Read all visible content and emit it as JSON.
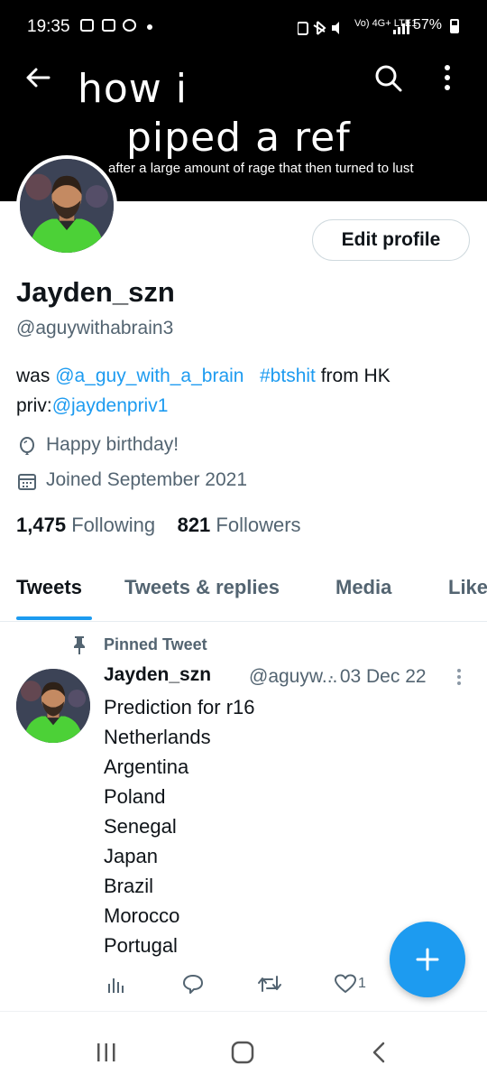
{
  "status_bar": {
    "time": "19:35",
    "signal_text": "Vo) 4G+ LTE1",
    "battery": "57%"
  },
  "banner": {
    "line1": "how i",
    "line2": "piped a ref",
    "caption": "after a large amount of rage that then turned to lust"
  },
  "profile": {
    "edit_label": "Edit profile",
    "display_name": "Jayden_szn",
    "handle": "@aguywithabrain3",
    "bio": {
      "prefix": "was ",
      "mention1": "@a_guy_with_a_brain",
      "hashtag": "#btshit",
      "after_hashtag": " from HK",
      "priv_label": "priv:",
      "mention2": "@jaydenpriv1"
    },
    "birthday": "Happy birthday!",
    "joined": "Joined September 2021",
    "following_count": "1,475",
    "following_label": "Following",
    "followers_count": "821",
    "followers_label": "Followers"
  },
  "tabs": [
    {
      "label": "Tweets",
      "active": true
    },
    {
      "label": "Tweets & replies",
      "active": false
    },
    {
      "label": "Media",
      "active": false
    },
    {
      "label": "Likes",
      "active": false
    }
  ],
  "tweet": {
    "pinned_label": "Pinned Tweet",
    "name": "Jayden_szn",
    "handle": "@aguyw...",
    "date": "· 03 Dec 22",
    "body": "Prediction for r16\nNetherlands\nArgentina\nPoland\nSenegal\nJapan\nBrazil\nMorocco\nPortugal",
    "like_count": "1"
  },
  "icons": {
    "back": "arrow-left-icon",
    "search": "search-icon",
    "more": "more-vertical-icon",
    "birthday": "balloon-icon",
    "joined": "calendar-icon",
    "pin": "pin-icon",
    "views": "analytics-icon",
    "reply": "reply-icon",
    "retweet": "retweet-icon",
    "like": "heart-icon",
    "compose": "plus-icon"
  },
  "colors": {
    "accent": "#1d9bf0",
    "text_primary": "#0f1419",
    "text_secondary": "#536471",
    "banner_bg": "#000000"
  }
}
